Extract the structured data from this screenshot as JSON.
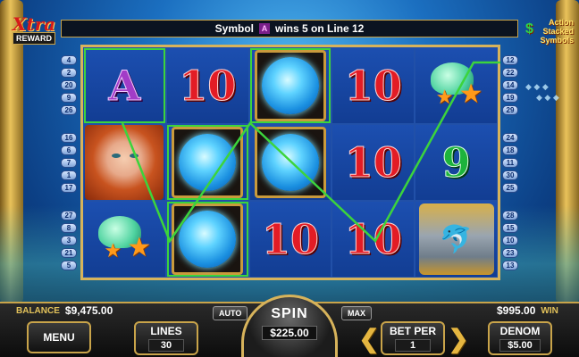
{
  "win_message": {
    "prefix": "Symbol",
    "symbol": "A",
    "suffix": "wins 5 on Line 12"
  },
  "logo_left": {
    "line1": "Xtra",
    "line2": "REWARD"
  },
  "logo_right": {
    "line1": "Action",
    "line2": "Stacked",
    "line3": "Symbols"
  },
  "reels": [
    [
      "A",
      "10",
      "orb",
      "10",
      "shell"
    ],
    [
      "portrait",
      "orb",
      "orb",
      "10",
      "9"
    ],
    [
      "shell",
      "orb",
      "10",
      "10",
      "dolphin"
    ]
  ],
  "left_lines": [
    "4",
    "2",
    "20",
    "9",
    "26",
    "16",
    "6",
    "7",
    "1",
    "17",
    "27",
    "8",
    "3",
    "21",
    "5"
  ],
  "right_lines": [
    "12",
    "22",
    "14",
    "19",
    "29",
    "24",
    "18",
    "11",
    "30",
    "25",
    "28",
    "15",
    "10",
    "23",
    "13"
  ],
  "panel": {
    "balance_label": "BALANCE",
    "balance_value": "$9,475.00",
    "win_value": "$995.00",
    "win_label": "WIN",
    "menu_label": "MENU",
    "lines_label": "LINES",
    "lines_value": "30",
    "auto_label": "AUTO",
    "max_label": "MAX",
    "spin_label": "SPIN",
    "spin_value": "$225.00",
    "betper_label": "BET PER",
    "betper_value": "1",
    "denom_label": "DENOM",
    "denom_value": "$5.00"
  },
  "colors": {
    "gold": "#c9a44a",
    "win_line": "#3cd43c",
    "ten_red": "#e31c25",
    "nine_green": "#1db33c",
    "a_purple": "#a23cc7"
  },
  "icons": {
    "arrow_left": "chevron-left-icon",
    "arrow_right": "chevron-right-icon"
  }
}
